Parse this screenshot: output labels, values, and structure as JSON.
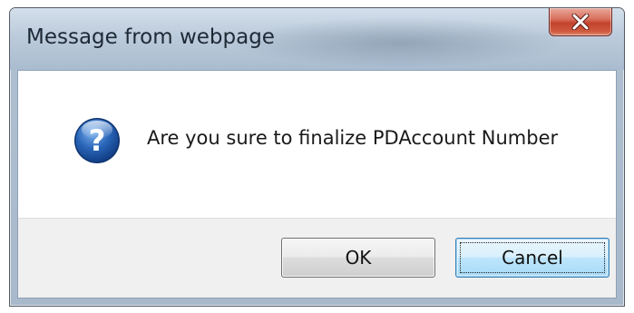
{
  "dialog": {
    "title": "Message from webpage",
    "close_icon": "close-x-icon",
    "message_icon": "question-icon",
    "message": "Are you sure to finalize PDAccount Number",
    "buttons": {
      "ok_label": "OK",
      "cancel_label": "Cancel"
    }
  },
  "colors": {
    "close_button": "#c2432c",
    "question_icon_blue": "#1d5aa8",
    "focused_button": "#bee6fd"
  }
}
